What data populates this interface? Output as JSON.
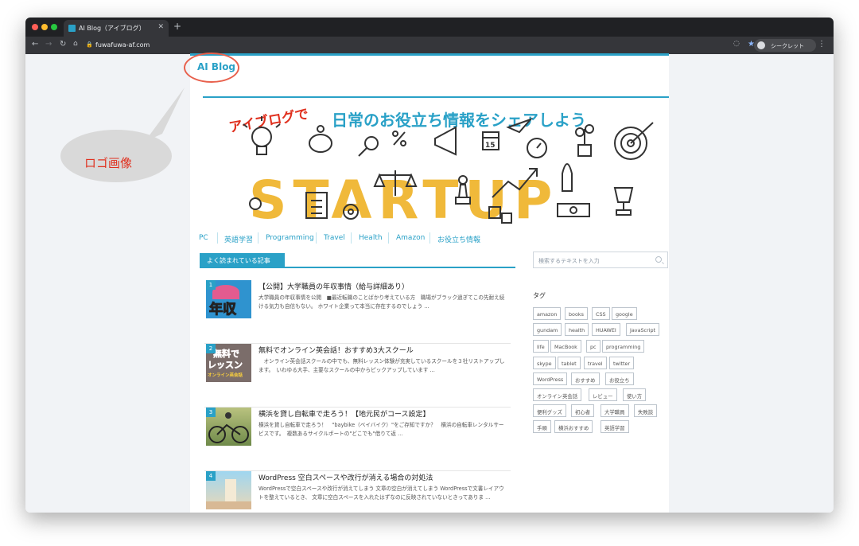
{
  "browser": {
    "tab_title": "AI Blog（アイブログ）",
    "url": "fuwafuwa-af.com",
    "incognito_label": "シークレット"
  },
  "site": {
    "logo_text": "AI Blog",
    "annotation_text": "ロゴ画像",
    "banner": {
      "headline_red": "アイブログで",
      "headline_teal": "日常のお役立ち情報をシェアしよう",
      "big_word": "STARTUP",
      "calendar_day": "15"
    },
    "nav": [
      "PC",
      "英語学習",
      "Programming",
      "Travel",
      "Health",
      "Amazon",
      "お役立ち情報"
    ],
    "section_title": "よく読まれている記事",
    "posts": [
      {
        "rank": "1",
        "title": "【公開】大学職員の年収事情（給与詳細あり）",
        "desc": "大学職員の年収事情を公開　■最近転職のことばかり考えている方　職場がブラック過ぎてこの先耐え続ける気力も自信もない。 ホワイト企業って本当に存在するのでしょう ...",
        "thumb_text": "年収"
      },
      {
        "rank": "2",
        "title": "無料でオンライン英会話！おすすめ3大スクール",
        "desc": "　オンライン英会話スクールの中でも、無料レッスン体験が充実しているスクールを３社リストアップします。　いわゆる大手、主要なスクールの中からピックアップしています ...",
        "thumb_line1": "無料で",
        "thumb_line2": "レッスン",
        "thumb_line3": "オンライン英会話"
      },
      {
        "rank": "3",
        "title": "横浜を貸し自転車で走ろう！【地元民がコース設定】",
        "desc": "横浜を貸し自転車で走ろう！　\"baybike（ベイバイク）\"をご存知ですか？　横浜の自転車レンタルサービスです。　複数あるサイクルポートの\"どこでも\"借りて返 ..."
      },
      {
        "rank": "4",
        "title": "WordPress 空白スペースや改行が消える場合の対処法",
        "desc": "WordPressで空白スペースや改行が消えてしまう 文章の空白が消えてしまう WordPressで文書レイアウトを整えているとき、 文章に空白スペースを入れたはずなのに反映されていないときってありま ..."
      }
    ],
    "search_placeholder": "検索するテキストを入力",
    "tag_heading": "タグ",
    "tags": [
      "amazon",
      "books",
      "CSS",
      "google",
      "gundam",
      "health",
      "HUAWEI",
      "JavaScript",
      "life",
      "MacBook",
      "pc",
      "programming",
      "skype",
      "tablet",
      "travel",
      "twitter",
      "WordPress",
      "おすすめ",
      "お役立ち",
      "オンライン英会話",
      "レビュー",
      "使い方",
      "便利グッズ",
      "初心者",
      "大学職員",
      "失敗談",
      "手順",
      "横浜おすすめ",
      "英語学習"
    ]
  },
  "colors": {
    "accent": "#2aa1c7",
    "banner_yellow": "#f0b93a",
    "annotation_red": "#e0301e"
  }
}
